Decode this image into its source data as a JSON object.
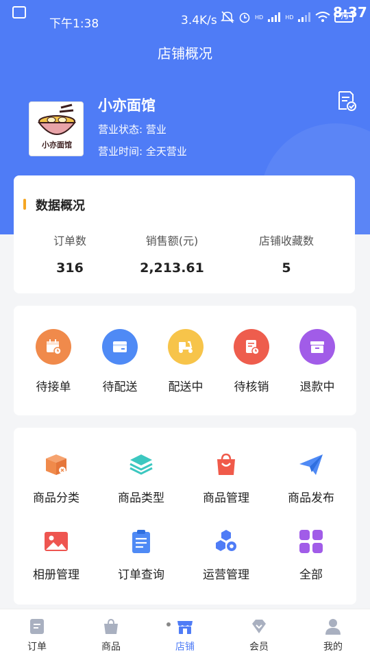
{
  "status_bar": {
    "time": "下午1:38",
    "speed": "3.4K/s",
    "hd1": "HD",
    "hd2": "HD",
    "battery": "79",
    "clock": "8:37"
  },
  "header": {
    "title": "店铺概况"
  },
  "store": {
    "logo_text": "小亦面馆",
    "name": "小亦面馆",
    "status": "营业状态: 营业",
    "hours": "营业时间: 全天营业"
  },
  "stats": {
    "title": "数据概况",
    "items": [
      {
        "label": "订单数",
        "value": "316"
      },
      {
        "label": "销售额(元)",
        "value": "2,213.61"
      },
      {
        "label": "店铺收藏数",
        "value": "5"
      }
    ]
  },
  "orders": {
    "items": [
      {
        "label": "待接单",
        "icon": "calendar-clock-icon",
        "color": "#f08a4b"
      },
      {
        "label": "待配送",
        "icon": "card-icon",
        "color": "#4f8af5"
      },
      {
        "label": "配送中",
        "icon": "scooter-icon",
        "color": "#f7c44a"
      },
      {
        "label": "待核销",
        "icon": "document-clock-icon",
        "color": "#ee5d4d"
      },
      {
        "label": "退款中",
        "icon": "box-icon",
        "color": "#a15ce8"
      }
    ]
  },
  "tools": {
    "items": [
      {
        "label": "商品分类",
        "icon": "package-icon",
        "color": "#f08a4b"
      },
      {
        "label": "商品类型",
        "icon": "layers-icon",
        "color": "#3cc7c0"
      },
      {
        "label": "商品管理",
        "icon": "shopping-bag-icon",
        "color": "#f05a4a"
      },
      {
        "label": "商品发布",
        "icon": "paper-plane-icon",
        "color": "#4f8af5"
      },
      {
        "label": "相册管理",
        "icon": "image-icon",
        "color": "#ee5550"
      },
      {
        "label": "订单查询",
        "icon": "clipboard-icon",
        "color": "#4f8af5"
      },
      {
        "label": "运营管理",
        "icon": "hexagon-gear-icon",
        "color": "#4f7cf6"
      },
      {
        "label": "全部",
        "icon": "grid-icon",
        "color": "#a15ce8"
      }
    ]
  },
  "tabbar": {
    "items": [
      {
        "label": "订单",
        "icon": "order-icon"
      },
      {
        "label": "商品",
        "icon": "bag-icon"
      },
      {
        "label": "店铺",
        "icon": "store-icon",
        "active": true
      },
      {
        "label": "会员",
        "icon": "diamond-icon"
      },
      {
        "label": "我的",
        "icon": "user-icon"
      }
    ]
  },
  "colors": {
    "primary": "#4f7cf6",
    "accent_bar": "#f5a623",
    "tab_inactive": "#a9b0c0"
  }
}
